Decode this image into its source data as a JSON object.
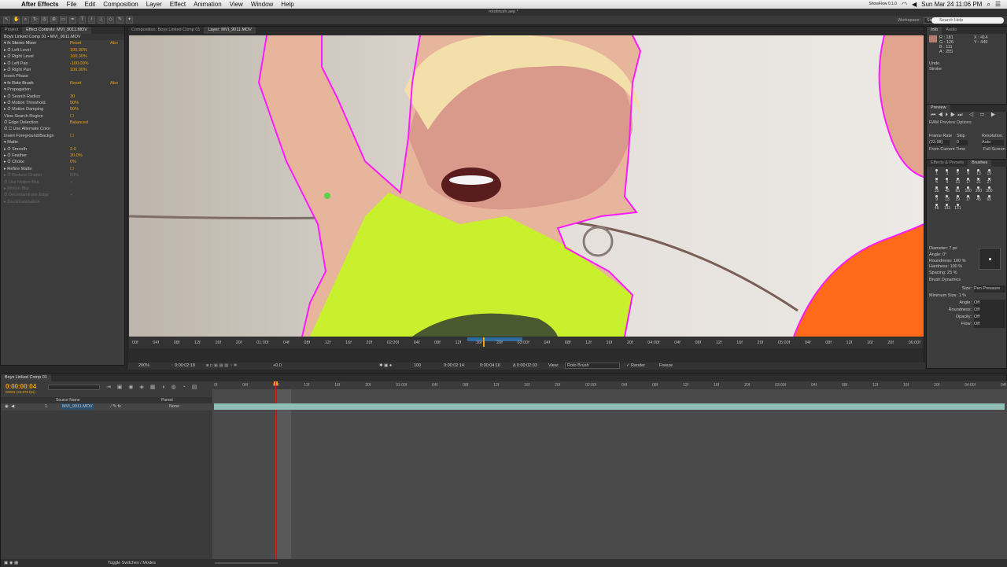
{
  "menubar": {
    "app": "After Effects",
    "items": [
      "File",
      "Edit",
      "Composition",
      "Layer",
      "Effect",
      "Animation",
      "View",
      "Window",
      "Help"
    ],
    "clock": "Sun Mar 24  11:06 PM",
    "battery": "ShowFlow 0.1.0"
  },
  "toolbar": {
    "doc_title": "rotobrush.aep *",
    "workspace_label": "Workspace:",
    "workspace_value": "Standard",
    "search_placeholder": "Search Help"
  },
  "effects_panel": {
    "tab_project": "Project",
    "tab_effects": "Effect Controls: MVI_9011.MOV",
    "breadcrumb": "Boys Linked Comp 01 • MVI_9011.MOV",
    "rows": [
      {
        "label": "▾ fx  Stereo Mixer",
        "value": "Reset",
        "about": "Abo",
        "hdr": true
      },
      {
        "label": "   ▸ ⏱ Left Level",
        "value": "100.00%"
      },
      {
        "label": "   ▸ ⏱ Right Level",
        "value": "100.00%"
      },
      {
        "label": "   ▸ ⏱ Left Pan",
        "value": "-100.00%"
      },
      {
        "label": "   ▸ ⏱ Right Pan",
        "value": "100.00%"
      },
      {
        "label": "                                      Invert Phase",
        "value": ""
      },
      {
        "label": "▾ fx  Roto Brush",
        "value": "Reset",
        "about": "Abo",
        "hdr": true
      },
      {
        "label": "   ▾ Propagation",
        "value": ""
      },
      {
        "label": "      ▸ ⏱ Search Radius",
        "value": "30"
      },
      {
        "label": "      ▸ ⏱ Motion Threshold",
        "value": "50%"
      },
      {
        "label": "      ▸ ⏱ Motion Damping",
        "value": "50%"
      },
      {
        "label": "         View Search Region",
        "value": "☐"
      },
      {
        "label": "      ⏱ Edge Detection",
        "value": "Balanced"
      },
      {
        "label": "      ⏱ ☐ Use Alternate Color",
        "value": ""
      },
      {
        "label": "   Invert Foreground/Backgn",
        "value": "☐"
      },
      {
        "label": "   ▾ Matte",
        "value": ""
      },
      {
        "label": "      ▸ ⏱ Smooth",
        "value": "2.0"
      },
      {
        "label": "      ▸ ⏱ Feather",
        "value": "20.0%"
      },
      {
        "label": "      ▸ ⏱ Choke",
        "value": "0%"
      },
      {
        "label": "      ▸ Refine Matte",
        "value": "☐"
      },
      {
        "label": "      ▸ ⏱ Reduce Chatter",
        "value": "50%",
        "dim": true
      },
      {
        "label": "         ⏱ Use Motion Blur",
        "value": "✓",
        "dim": true
      },
      {
        "label": "      ▸ Motion Blur",
        "value": "",
        "dim": true
      },
      {
        "label": "         ⏱ Decontaminate Edge",
        "value": "✓",
        "dim": true
      },
      {
        "label": "      ▸ Decontamination",
        "value": "",
        "dim": true
      }
    ]
  },
  "viewer": {
    "tab_comp": "Composition: Boys Linked Comp 01",
    "tab_layer": "Layer: MVI_9011.MOV",
    "ruler_ticks": [
      "00f",
      "04f",
      "08f",
      "12f",
      "16f",
      "20f",
      "01:00f",
      "04f",
      "08f",
      "12f",
      "16f",
      "20f",
      "02:00f",
      "04f",
      "08f",
      "12f",
      "16f",
      "20f",
      "03:00f",
      "04f",
      "08f",
      "12f",
      "16f",
      "20f",
      "04:00f",
      "04f",
      "08f",
      "12f",
      "16f",
      "20f",
      "05:00f",
      "04f",
      "08f",
      "12f",
      "16f",
      "20f",
      "06:00f"
    ],
    "zoom": "200%",
    "current_time": "0:00:02:18",
    "exposure": "+0.0",
    "in_time": "0:00:02:14",
    "out_time": "0:00:04:16",
    "duration": "Δ 0:00:02:03",
    "view_label": "View:",
    "view_value": "Roto Brush",
    "render_label": "Render",
    "freeze_label": "Freeze",
    "mag": "100"
  },
  "info_panel": {
    "tab_info": "Info",
    "tab_audio": "Audio",
    "r": "R : 181",
    "g": "G : 126",
    "b": "B : 111",
    "a": "A : 255",
    "x": "X : 414",
    "y": "Y : 449",
    "undo": "Undo",
    "stroke": "Stroke"
  },
  "preview_panel": {
    "tab": "Preview",
    "ram": "RAM Preview Options",
    "frame_rate": "Frame Rate",
    "skip": "Skip",
    "resolution": "Resolution",
    "fps": "(23.98)",
    "skip_val": "0",
    "res_val": "Auto",
    "from_current": "From Current Time",
    "full_screen": "Full Screen"
  },
  "brushes_panel": {
    "tab_effects": "Effects & Presets",
    "tab_brushes": "Brushes",
    "sizes": [
      "1",
      "3",
      "5",
      "9",
      "13",
      "19",
      "5",
      "9",
      "13",
      "17",
      "21",
      "27",
      "35",
      "45",
      "65",
      "100",
      "200",
      "300",
      "9",
      "13",
      "19",
      "17",
      "45",
      "65",
      "45",
      "131",
      "131"
    ],
    "diameter": "Diameter: 7 px",
    "angle": "Angle: 0°",
    "roundness": "Roundness: 100 %",
    "hardness": "Hardness: 100 %",
    "spacing": "Spacing: 25 %",
    "dynamics": "Brush Dynamics",
    "size_label": "Size:",
    "size_val": "Pen Pressure",
    "min_size": "Minimum Size: 1 %",
    "angle_label": "Angle:",
    "off": "Off",
    "roundness_label": "Roundness:",
    "opacity_label": "Opacity:",
    "flow_label": "Flow:"
  },
  "timeline": {
    "tab": "Boys Linked Comp 01",
    "timecode": "0:00:00:04",
    "frames": "00004 (23.976 fps)",
    "col_source": "Source Name",
    "col_parent": "Parent",
    "layer_num": "1",
    "layer_name": "MVI_9011.MOV",
    "parent_val": "None",
    "ruler": [
      "0f",
      "04f",
      "08f",
      "12f",
      "16f",
      "20f",
      "01:00f",
      "04f",
      "08f",
      "12f",
      "16f",
      "20f",
      "02:00f",
      "04f",
      "08f",
      "12f",
      "16f",
      "20f",
      "03:00f",
      "04f",
      "08f",
      "12f",
      "16f",
      "20f",
      "04:00f",
      "04f"
    ],
    "toggle": "Toggle Switches / Modes"
  },
  "colors": {
    "accent": "#e8a317",
    "matte_outline": "#ff1aff",
    "layer_bar": "#8fbfb7"
  }
}
